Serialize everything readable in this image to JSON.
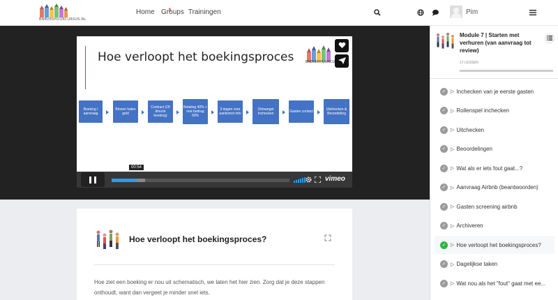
{
  "header": {
    "logo_text": "BNBVERHUURCURSUS.NL",
    "nav": [
      {
        "label": "Home",
        "badge": "2"
      },
      {
        "label": "Groups"
      },
      {
        "label": "Trainingen"
      }
    ],
    "icons": [
      "search-icon",
      "globe-icon",
      "chat-icon",
      "menu-icon"
    ],
    "user_name": "Pim"
  },
  "video": {
    "slide_title": "Hoe verloopt het boekingsproces",
    "slide_logo_text": "BNBVERHUURCURSUS",
    "steps": [
      "Boeking / aanvraag",
      "Binnen halen geld",
      "Contract (Of directe boeking)",
      "Betaling 40% + rest bedrag 60%",
      "3 dagen voor aankomst info",
      "Ontvangst Inchecken",
      "Gasten contact",
      "Uitchecken & Beoordeling"
    ],
    "time": "00:54",
    "progress": 0.14,
    "buffered": 0.19,
    "brand": "vimeo"
  },
  "content": {
    "title": "Hoe verloopt het boekingsproces?",
    "text": "Hoe ziet een boeking er nou uit schematisch, we laten het hier zien. Zorg dat je deze stappen onthoudt, want dan vergeet je minder snel iets."
  },
  "sidebar": {
    "module_title": "Module 7 | Starten met verhuren (van aanvraag tot review)",
    "lesson_count": "17 LESSEN",
    "lessons": [
      {
        "label": "Inchecken van je eerste gasten",
        "done": false
      },
      {
        "label": "Rollenspel inchecken",
        "done": false
      },
      {
        "label": "Uitchecken",
        "done": false
      },
      {
        "label": "Beoordelingen",
        "done": false
      },
      {
        "label": "Wat als er iets fout gaat...?",
        "done": false
      },
      {
        "label": "Aanvraag Airbnb (beantwoorden)",
        "done": false
      },
      {
        "label": "Gasten screening airbnb",
        "done": false
      },
      {
        "label": "Archiveren",
        "done": false
      },
      {
        "label": "Hoe verloopt het boekingsproces?",
        "done": true,
        "active": true
      },
      {
        "label": "Dagelijkse taken",
        "done": false
      },
      {
        "label": "Wat nou als het \"fout\" gaat met ee...",
        "done": false
      }
    ]
  },
  "colors": {
    "accent": "#4472c4",
    "progress": "#2d9bea",
    "done": "#2db83d"
  }
}
